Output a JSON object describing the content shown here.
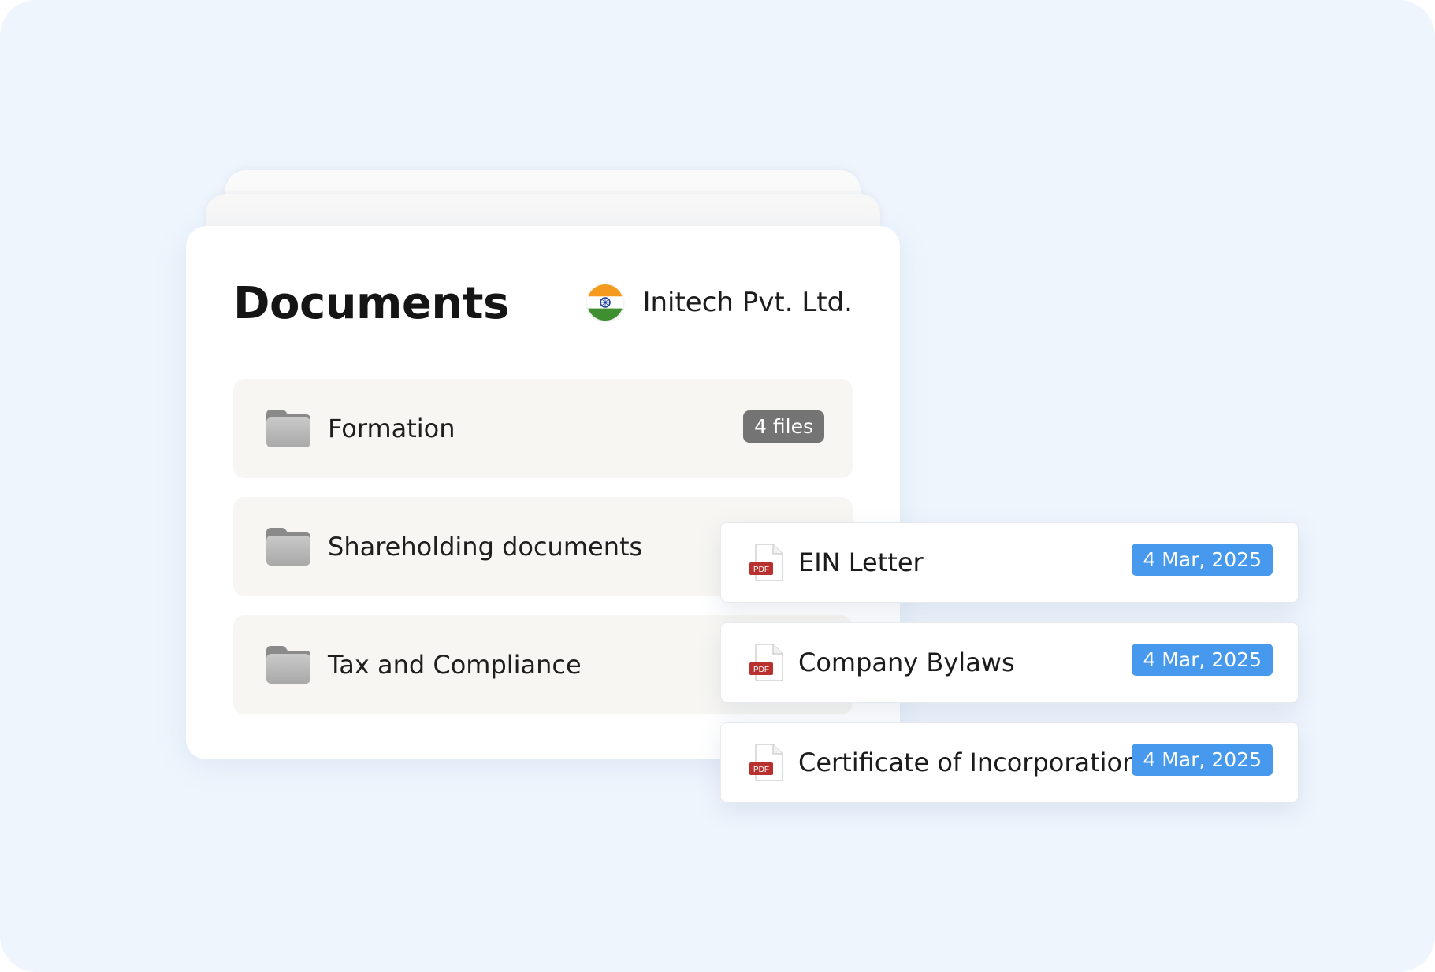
{
  "documents": {
    "title": "Documents",
    "company": {
      "name": "Initech Pvt. Ltd.",
      "flag_icon": "india-flag-icon"
    },
    "folders": [
      {
        "label": "Formation",
        "badge": "4 files"
      },
      {
        "label": "Shareholding documents",
        "badge": ""
      },
      {
        "label": "Tax and Compliance",
        "badge": ""
      }
    ]
  },
  "files": [
    {
      "name": "EIN Letter",
      "date": "4 Mar, 2025",
      "type_label": "PDF"
    },
    {
      "name": "Company Bylaws",
      "date": "4 Mar, 2025",
      "type_label": "PDF"
    },
    {
      "name": "Certificate of Incorporation",
      "date": "4 Mar, 2025",
      "type_label": "PDF"
    }
  ],
  "colors": {
    "background": "#eef5fd",
    "folder_row": "#f7f6f2",
    "files_badge": "#747474",
    "date_badge": "#4699ec",
    "pdf_red": "#b8312f"
  }
}
